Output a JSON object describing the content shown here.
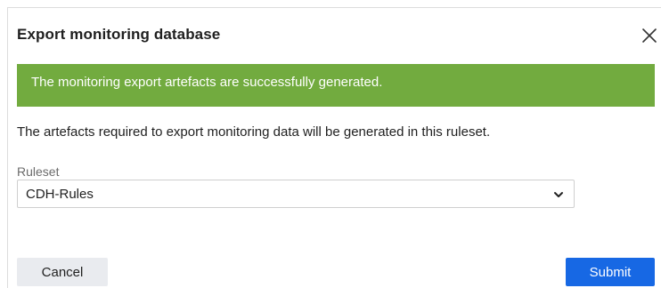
{
  "dialog": {
    "title": "Export monitoring database",
    "close_icon": "close-icon"
  },
  "banner": {
    "message": "The monitoring export artefacts are successfully generated.",
    "color": "#72ab3f"
  },
  "description": "The artefacts required to export monitoring data will be generated in this ruleset.",
  "ruleset": {
    "label": "Ruleset",
    "selected": "CDH-Rules",
    "icon": "chevron-down-icon"
  },
  "actions": {
    "cancel_label": "Cancel",
    "submit_label": "Submit",
    "submit_color": "#1768e4"
  }
}
